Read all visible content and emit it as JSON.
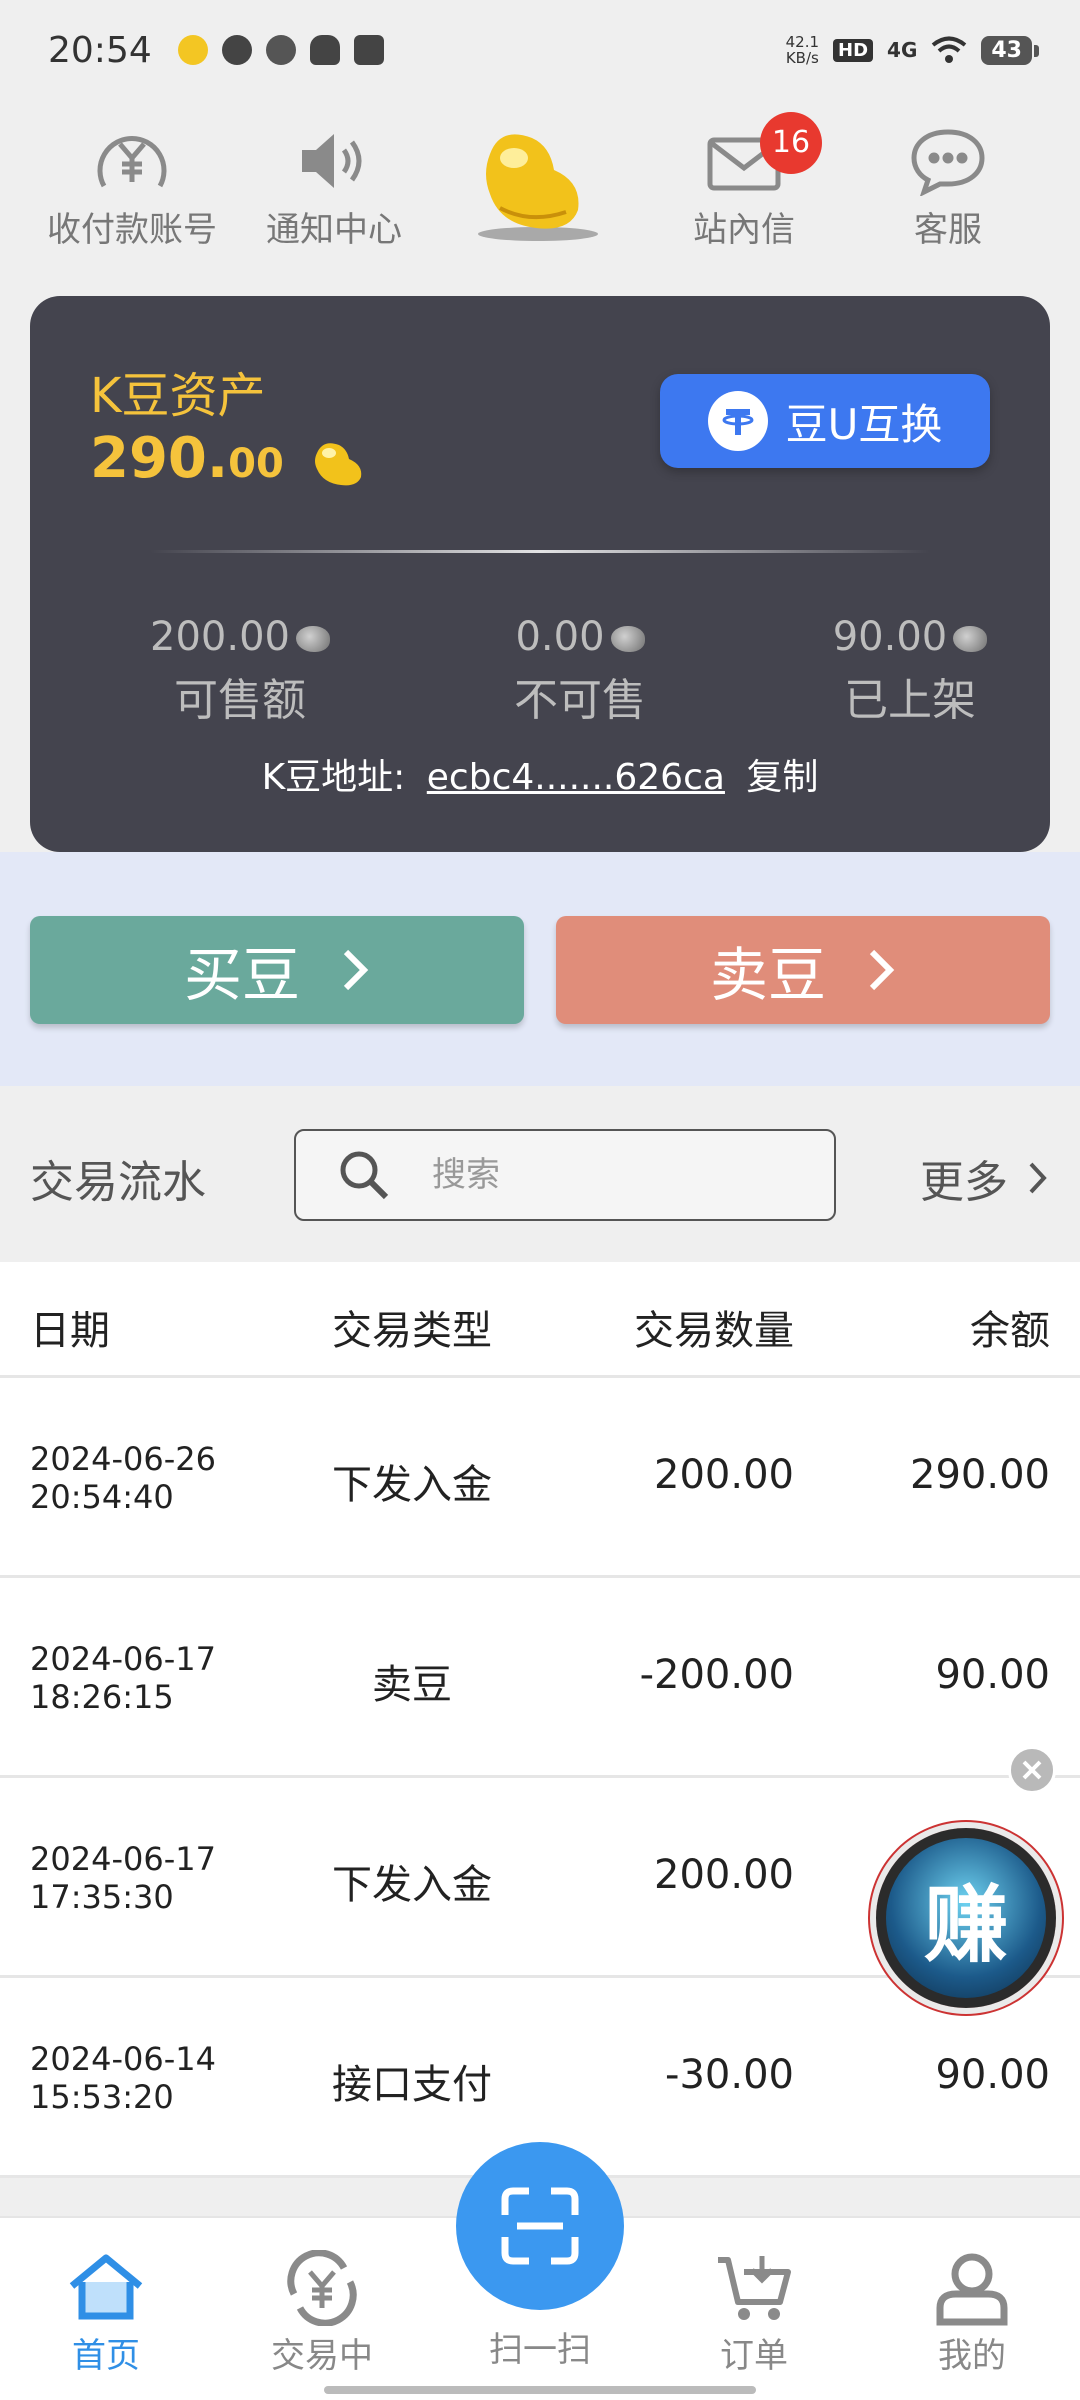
{
  "status_bar": {
    "time": "20:54",
    "net_speed_value": "42.1",
    "net_speed_unit": "KB/s",
    "hd": "HD",
    "network": "4G",
    "battery": "43"
  },
  "top_nav": {
    "items": [
      {
        "label": "收付款账号",
        "icon": "yuan-circle-icon"
      },
      {
        "label": "通知中心",
        "icon": "speaker-icon"
      },
      {
        "label": "站內信",
        "icon": "mail-icon",
        "badge": "16"
      },
      {
        "label": "客服",
        "icon": "chat-bubble-icon"
      }
    ]
  },
  "asset_card": {
    "title": "K豆资产",
    "value_int": "290.",
    "value_dec": "00",
    "exchange_label": "豆U互换",
    "stats": [
      {
        "value": "200.00",
        "label": "可售额"
      },
      {
        "value": "0.00",
        "label": "不可售"
      },
      {
        "value": "90.00",
        "label": "已上架"
      }
    ],
    "address_label": "K豆地址:",
    "address": "ecbc4.......626ca",
    "copy_label": "复制"
  },
  "trade": {
    "buy_label": "买豆",
    "sell_label": "卖豆"
  },
  "transactions": {
    "title": "交易流水",
    "search_placeholder": "搜索",
    "more_label": "更多",
    "columns": [
      "日期",
      "交易类型",
      "交易数量",
      "余额"
    ],
    "rows": [
      {
        "date": "2024-06-26",
        "time": "20:54:40",
        "type": "下发入金",
        "amount": "200.00",
        "balance": "290.00"
      },
      {
        "date": "2024-06-17",
        "time": "18:26:15",
        "type": "卖豆",
        "amount": "-200.00",
        "balance": "90.00"
      },
      {
        "date": "2024-06-17",
        "time": "17:35:30",
        "type": "下发入金",
        "amount": "200.00",
        "balance": ""
      },
      {
        "date": "2024-06-14",
        "time": "15:53:20",
        "type": "接口支付",
        "amount": "-30.00",
        "balance": "90.00"
      }
    ]
  },
  "float_widget": {
    "label": "赚"
  },
  "bottom_nav": {
    "items": [
      {
        "label": "首页",
        "icon": "home-icon",
        "active": true
      },
      {
        "label": "交易中",
        "icon": "yuan-cycle-icon"
      },
      {
        "label": "扫一扫",
        "icon": "scan-icon"
      },
      {
        "label": "订单",
        "icon": "cart-icon"
      },
      {
        "label": "我的",
        "icon": "user-icon"
      }
    ]
  },
  "colors": {
    "card_bg": "#44444e",
    "gold": "#f5c33c",
    "exchange_blue": "#3d78f0",
    "buy_green": "#6aa99c",
    "sell_red": "#e08d7a",
    "active_blue": "#2f8fe6"
  }
}
